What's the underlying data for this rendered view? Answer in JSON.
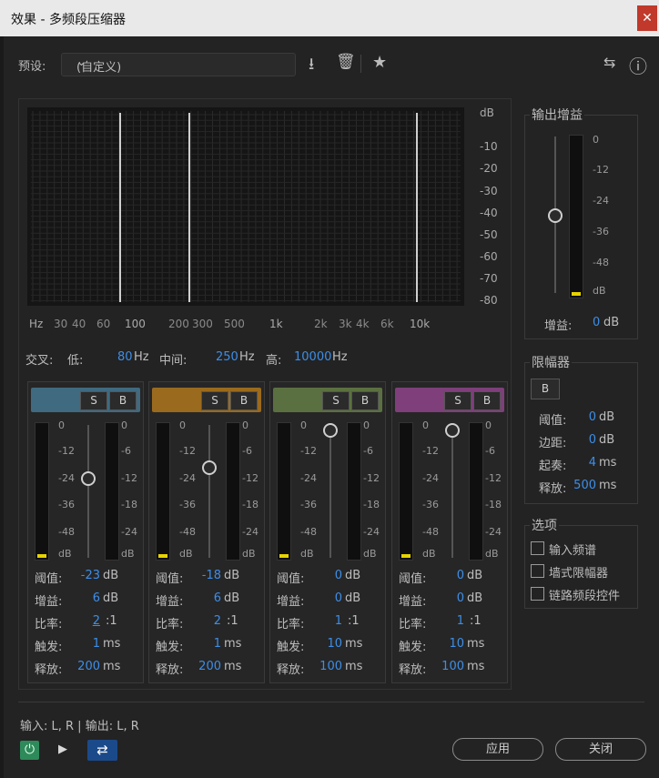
{
  "window": {
    "title": "效果 - 多频段压缩器",
    "close_glyph": "✕"
  },
  "preset": {
    "label": "预设:",
    "value": "(自定义)"
  },
  "icons": {
    "download": "⭳",
    "trash": "🗑",
    "star": "★",
    "route": "⇆",
    "info": "ⓘ",
    "power": "⏻",
    "play": "▶",
    "loop": "⇄",
    "chevron": "⌄"
  },
  "graph": {
    "db_labels": [
      "dB",
      "-10",
      "-20",
      "-30",
      "-40",
      "-50",
      "-60",
      "-70",
      "-80"
    ],
    "hz_labels": [
      "Hz",
      "30",
      "40",
      "60",
      "100",
      "200",
      "300",
      "500",
      "1k",
      "2k",
      "3k",
      "4k",
      "6k",
      "10k"
    ]
  },
  "crossover": {
    "label": "交叉:",
    "low_label": "低:",
    "low_value": "80",
    "low_unit": "Hz",
    "mid_label": "中间:",
    "mid_value": "250",
    "mid_unit": "Hz",
    "high_label": "高:",
    "high_value": "10000",
    "high_unit": "Hz"
  },
  "band_scale_left": [
    "0",
    "-12",
    "-24",
    "-36",
    "-48",
    "dB"
  ],
  "band_scale_right": [
    "0",
    "-6",
    "-12",
    "-18",
    "-24",
    "dB"
  ],
  "bands": [
    {
      "color": "#3f6a80",
      "s": "S",
      "b": "B",
      "threshold_label": "阈值:",
      "threshold": "-23",
      "threshold_unit": "dB",
      "gain_label": "增益:",
      "gain": "6",
      "gain_unit": "dB",
      "ratio_label": "比率:",
      "ratio": "2",
      "ratio_unit": ":1",
      "attack_label": "触发:",
      "attack": "1",
      "attack_unit": "ms",
      "release_label": "释放:",
      "release": "200",
      "release_unit": "ms",
      "threshold_level": 0.38
    },
    {
      "color": "#9a6a1e",
      "s": "S",
      "b": "B",
      "threshold_label": "阈值:",
      "threshold": "-18",
      "threshold_unit": "dB",
      "gain_label": "增益:",
      "gain": "6",
      "gain_unit": "dB",
      "ratio_label": "比率:",
      "ratio": "2",
      "ratio_unit": ":1",
      "attack_label": "触发:",
      "attack": "1",
      "attack_unit": "ms",
      "release_label": "释放:",
      "release": "200",
      "release_unit": "ms",
      "threshold_level": 0.29
    },
    {
      "color": "#5b7040",
      "s": "S",
      "b": "B",
      "threshold_label": "阈值:",
      "threshold": "0",
      "threshold_unit": "dB",
      "gain_label": "增益:",
      "gain": "0",
      "gain_unit": "dB",
      "ratio_label": "比率:",
      "ratio": "1",
      "ratio_unit": ":1",
      "attack_label": "触发:",
      "attack": "10",
      "attack_unit": "ms",
      "release_label": "释放:",
      "release": "100",
      "release_unit": "ms",
      "threshold_level": 0.0
    },
    {
      "color": "#7e3f7a",
      "s": "S",
      "b": "B",
      "threshold_label": "阈值:",
      "threshold": "0",
      "threshold_unit": "dB",
      "gain_label": "增益:",
      "gain": "0",
      "gain_unit": "dB",
      "ratio_label": "比率:",
      "ratio": "1",
      "ratio_unit": ":1",
      "attack_label": "触发:",
      "attack": "10",
      "attack_unit": "ms",
      "release_label": "释放:",
      "release": "100",
      "release_unit": "ms",
      "threshold_level": 0.0
    }
  ],
  "output_gain": {
    "title": "输出增益",
    "scale": [
      "0",
      "-12",
      "-24",
      "-36",
      "-48",
      "dB"
    ],
    "gain_label": "增益:",
    "gain": "0",
    "gain_unit": "dB",
    "level": 0.5
  },
  "limiter": {
    "title": "限幅器",
    "b": "B",
    "threshold_label": "阈值:",
    "threshold": "0",
    "threshold_unit": "dB",
    "margin_label": "边距:",
    "margin": "0",
    "margin_unit": "dB",
    "attack_label": "起奏:",
    "attack": "4",
    "attack_unit": "ms",
    "release_label": "释放:",
    "release": "500",
    "release_unit": "ms"
  },
  "options": {
    "title": "选项",
    "items": [
      "输入频谱",
      "墙式限幅器",
      "链路频段控件"
    ]
  },
  "footer": {
    "io": "输入: L, R | 输出: L, R",
    "apply": "应用",
    "close": "关闭"
  }
}
